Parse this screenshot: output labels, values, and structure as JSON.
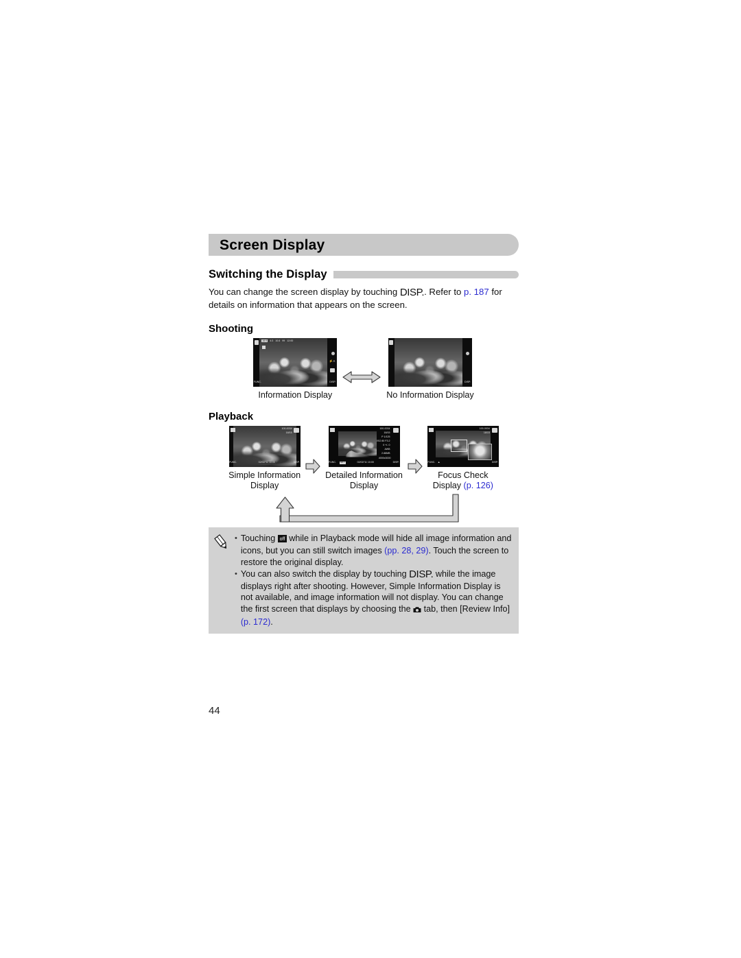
{
  "page": {
    "folio": "44"
  },
  "chapter": {
    "title": "Screen Display"
  },
  "section": {
    "title": "Switching the Display",
    "intro_part1": "You can change the screen display by touching ",
    "intro_disp": "DISP.",
    "intro_part2": ". Refer to ",
    "intro_link": "p. 187",
    "intro_part3": " for details on information that appears on the screen."
  },
  "shooting": {
    "heading": "Shooting",
    "screens": [
      {
        "caption": "Information Display",
        "osd": {
          "top_left_mode_icon": "portrait-mode-icon",
          "top_row": "16:9  4:3  10.6  99  12:00",
          "second_row": "AF-frame",
          "right_icons": [
            "record-dot",
            "flash-auto",
            "macro",
            "disp"
          ],
          "bottom_left": "FUNC."
        }
      },
      {
        "caption": "No Information Display",
        "osd": {
          "top_left_mode_icon": "portrait-mode-icon",
          "right_icons": [
            "record-dot",
            "disp"
          ],
          "bottom_left": ""
        }
      }
    ]
  },
  "playback": {
    "heading": "Playback",
    "screens": [
      {
        "caption_line1": "Simple Information",
        "caption_line2": "Display",
        "caption_link": "",
        "osd": {
          "top_left": "index-icon",
          "file_no": "100-0034",
          "frame_no": "18/15",
          "top_right": "edit-icon",
          "bottom_left": "FUNC.",
          "bottom_strip": "02/02/'11  10:00",
          "bottom_right": "DISP."
        }
      },
      {
        "caption_line1": "Detailed Information",
        "caption_line2": "Display",
        "caption_link": "",
        "osd": {
          "top_left": "index-icon",
          "file_no": "100-0034",
          "frame_no": "18/15",
          "top_right": "edit-icon",
          "exposure": "P  1/125",
          "iso": "ISO 80   F3.2",
          "ev": "0 +/- 0",
          "wb": "AWB",
          "size": "4000x3000",
          "file_size": "2.88MB",
          "date": "02/02/'11  10:00",
          "bottom_left": "FUNC.",
          "bottom_right": "DISP.",
          "histogram": "histogram-graph"
        }
      },
      {
        "caption_line1": "Focus Check",
        "caption_line2": "Display ",
        "caption_link": "(p. 126)",
        "osd": {
          "top_left": "index-icon",
          "file_no": "100-0034",
          "frame_no": "18/15",
          "top_right": "edit-icon",
          "bottom_left": "FUNC.",
          "bottom_right": "DISP."
        }
      }
    ]
  },
  "notes": [
    {
      "segments": [
        {
          "type": "text",
          "value": "Touching "
        },
        {
          "type": "icon",
          "value": "info-off-icon"
        },
        {
          "type": "text",
          "value": " while in Playback mode will hide all image information and icons, but you can still switch images "
        },
        {
          "type": "link",
          "value": "(pp. 28, 29)"
        },
        {
          "type": "text",
          "value": ". Touch the screen to restore the original display."
        }
      ]
    },
    {
      "segments": [
        {
          "type": "text",
          "value": "You can also switch the display by touching "
        },
        {
          "type": "disp",
          "value": "DISP."
        },
        {
          "type": "text",
          "value": " while the image displays right after shooting. However, Simple Information Display is not available, and image information will not display. You can change the first screen that displays by choosing the "
        },
        {
          "type": "icon",
          "value": "camera-tab-icon"
        },
        {
          "type": "text",
          "value": " tab, then [Review Info] "
        },
        {
          "type": "link",
          "value": "(p. 172)"
        },
        {
          "type": "text",
          "value": "."
        }
      ]
    }
  ],
  "colors": {
    "bar_gray": "#c8c8c8",
    "note_gray": "#d2d2d2",
    "link_blue": "#2b2bd0",
    "arrow_fill": "#d4d4d4",
    "arrow_stroke": "#3a3a3a"
  }
}
